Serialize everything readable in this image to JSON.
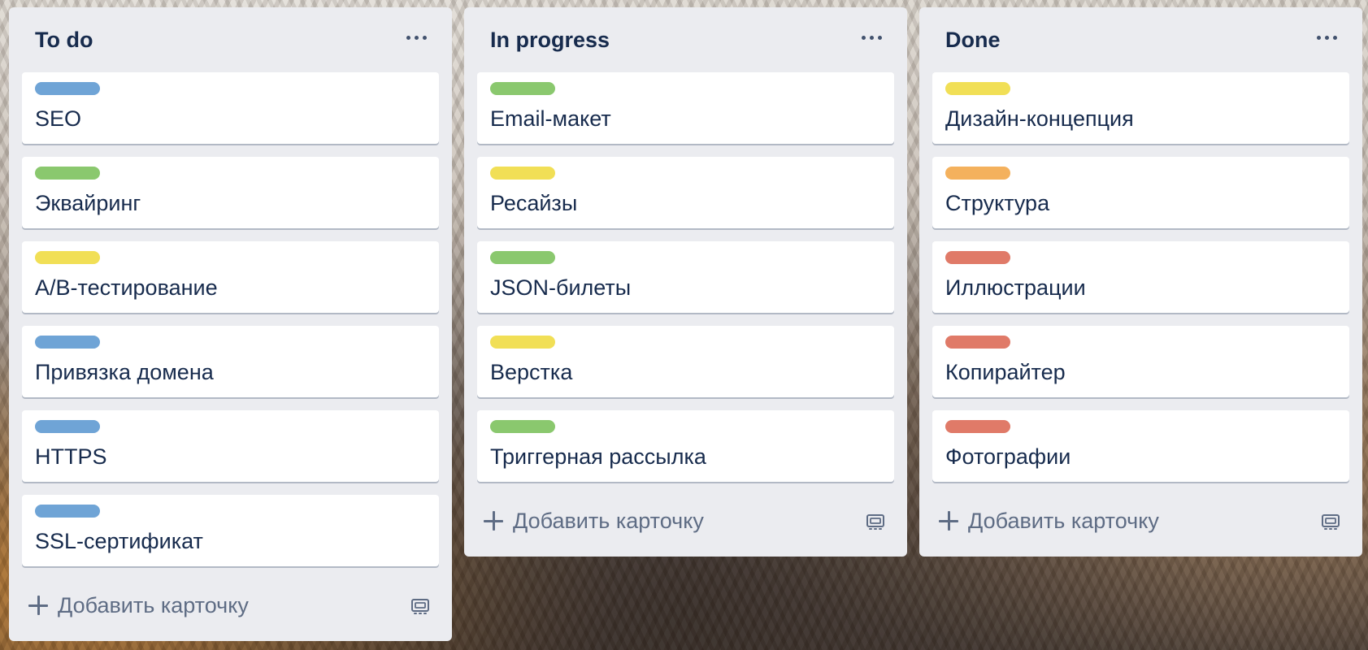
{
  "board": {
    "lists": [
      {
        "title": "To do",
        "add_card_label": "Добавить карточку",
        "cards": [
          {
            "title": "SEO",
            "label_color": "#6fa4d6"
          },
          {
            "title": "Эквайринг",
            "label_color": "#8ac86e"
          },
          {
            "title": "A/B-тестирование",
            "label_color": "#f1df56"
          },
          {
            "title": "Привязка домена",
            "label_color": "#6fa4d6"
          },
          {
            "title": "HTTPS",
            "label_color": "#6fa4d6"
          },
          {
            "title": "SSL-сертификат",
            "label_color": "#6fa4d6"
          }
        ]
      },
      {
        "title": "In progress",
        "add_card_label": "Добавить карточку",
        "cards": [
          {
            "title": "Email-макет",
            "label_color": "#8ac86e"
          },
          {
            "title": "Ресайзы",
            "label_color": "#f1df56"
          },
          {
            "title": "JSON-билеты",
            "label_color": "#8ac86e"
          },
          {
            "title": "Верстка",
            "label_color": "#f1df56"
          },
          {
            "title": "Триггерная рассылка",
            "label_color": "#8ac86e"
          }
        ]
      },
      {
        "title": "Done",
        "add_card_label": "Добавить карточку",
        "cards": [
          {
            "title": "Дизайн-концепция",
            "label_color": "#f1df56"
          },
          {
            "title": "Структура",
            "label_color": "#f4b15d"
          },
          {
            "title": "Иллюстрации",
            "label_color": "#e07a68"
          },
          {
            "title": "Копирайтер",
            "label_color": "#e07a68"
          },
          {
            "title": "Фотографии",
            "label_color": "#e07a68"
          }
        ]
      }
    ]
  },
  "icons": {
    "list_menu": "more-horizontal-icon",
    "add": "plus-icon",
    "template": "card-template-icon"
  },
  "colors": {
    "list_background": "#ebecf0",
    "card_background": "#ffffff",
    "title_text": "#172b4d",
    "muted_text": "#5e6c84"
  }
}
